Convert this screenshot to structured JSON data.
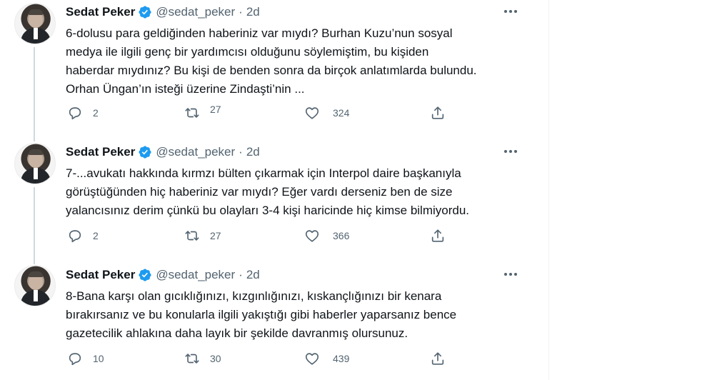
{
  "tweets": [
    {
      "name": "Sedat Peker",
      "handle": "@sedat_peker",
      "separator": "·",
      "time": "2d",
      "text_lines": [
        "6-dolusu para geldiğinden haberiniz var mıydı? Burhan Kuzu’nun sosyal",
        "medya ile ilgili genç bir yardımcısı olduğunu söylemiştim, bu kişiden",
        "haberdar mıydınız? Bu kişi de benden sonra da birçok anlatımlarda bulundu.",
        "Orhan Üngan’ın isteği üzerine Zindaşti’nin ..."
      ],
      "replies": "2",
      "retweets": "27",
      "likes": "324"
    },
    {
      "name": "Sedat Peker",
      "handle": "@sedat_peker",
      "separator": "·",
      "time": "2d",
      "text_lines": [
        "7-...avukatı hakkında kırmzı bülten çıkarmak için Interpol daire başkanıyla",
        "görüştüğünden hiç haberiniz var mıydı? Eğer vardı derseniz ben de size",
        "yalancısınız derim çünkü bu olayları 3-4 kişi haricinde hiç kimse bilmiyordu."
      ],
      "replies": "2",
      "retweets": "27",
      "likes": "366"
    },
    {
      "name": "Sedat Peker",
      "handle": "@sedat_peker",
      "separator": "·",
      "time": "2d",
      "text_lines": [
        "8-Bana karşı olan gıcıklığınızı, kızgınlığınızı, kıskançlığınızı bir kenara",
        "bırakırsanız ve bu konularla ilgili yakıştığı gibi haberler yaparsanız bence",
        "gazetecilik ahlakına daha layık bir şekilde davranmış olursunuz."
      ],
      "replies": "10",
      "retweets": "30",
      "likes": "439"
    }
  ],
  "icons": {
    "verified": "verified-badge-icon",
    "more": "more-options-icon",
    "reply": "reply-icon",
    "retweet": "retweet-icon",
    "like": "like-icon",
    "share": "share-icon"
  },
  "colors": {
    "verified": "#1d9bf0",
    "secondary_text": "#536471",
    "thread_line": "#cfd9de"
  }
}
